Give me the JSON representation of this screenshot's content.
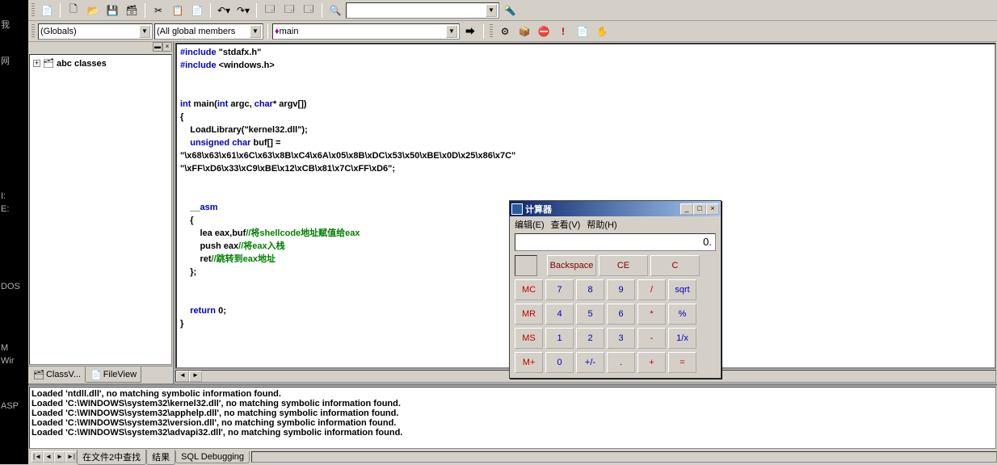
{
  "sidebar_os": [
    "我",
    "网",
    "I:",
    "E:",
    "DOS",
    "M",
    "Wir",
    "ASP"
  ],
  "toolbar1": {
    "combo_empty": ""
  },
  "toolbar2": {
    "globals": "(Globals)",
    "members": "(All global members",
    "function": "main"
  },
  "tree": {
    "root": "abc classes"
  },
  "side_tabs": {
    "class": "ClassV...",
    "file": "FileView"
  },
  "code": {
    "l1a": "#include",
    "l1b": " \"stdafx.h\"",
    "l2a": "#include",
    "l2b": " <windows.h>",
    "l4a": "int",
    "l4b": " main(",
    "l4c": "int",
    "l4d": " argc, ",
    "l4e": "char",
    "l4f": "* argv[])",
    "l5": "{",
    "l6": "    LoadLibrary(\"kernel32.dll\");",
    "l7a": "    ",
    "l7b": "unsigned",
    "l7c": " ",
    "l7d": "char",
    "l7e": " buf[] =",
    "l8": "\"\\x68\\x63\\x61\\x6C\\x63\\x8B\\xC4\\x6A\\x05\\x8B\\xDC\\x53\\x50\\xBE\\x0D\\x25\\x86\\x7C\"",
    "l9": "\"\\xFF\\xD6\\x33\\xC9\\xBE\\x12\\xCB\\x81\\x7C\\xFF\\xD6\";",
    "l11a": "    __",
    "l11b": "asm",
    "l12": "    {",
    "l13a": "        lea eax,buf",
    "l13b": "//将shellcode地址赋值给eax",
    "l14a": "        push eax",
    "l14b": "//将eax入栈",
    "l15a": "        ret",
    "l15b": "//跳转到eax地址",
    "l16": "    };",
    "l18a": "    ",
    "l18b": "return",
    "l18c": " 0;",
    "l19": "}"
  },
  "output": [
    "Loaded 'ntdll.dll', no matching symbolic information found.",
    "Loaded 'C:\\WINDOWS\\system32\\kernel32.dll', no matching symbolic information found.",
    "Loaded 'C:\\WINDOWS\\system32\\apphelp.dll', no matching symbolic information found.",
    "Loaded 'C:\\WINDOWS\\system32\\version.dll', no matching symbolic information found.",
    "Loaded 'C:\\WINDOWS\\system32\\advapi32.dll', no matching symbolic information found."
  ],
  "out_tabs": [
    "在文件2中查找",
    "结果",
    "SQL Debugging"
  ],
  "calc": {
    "title": "计算器",
    "menus": {
      "edit": "编辑(E)",
      "view": "查看(V)",
      "help": "帮助(H)"
    },
    "display": "0.",
    "backspace": "Backspace",
    "ce": "CE",
    "c": "C",
    "mc": "MC",
    "mr": "MR",
    "ms": "MS",
    "mp": "M+",
    "n7": "7",
    "n8": "8",
    "n9": "9",
    "n4": "4",
    "n5": "5",
    "n6": "6",
    "n1": "1",
    "n2": "2",
    "n3": "3",
    "n0": "0",
    "div": "/",
    "mul": "*",
    "sub": "-",
    "add": "+",
    "sqrt": "sqrt",
    "pct": "%",
    "inv": "1/x",
    "pm": "+/-",
    "dot": ".",
    "eq": "="
  }
}
